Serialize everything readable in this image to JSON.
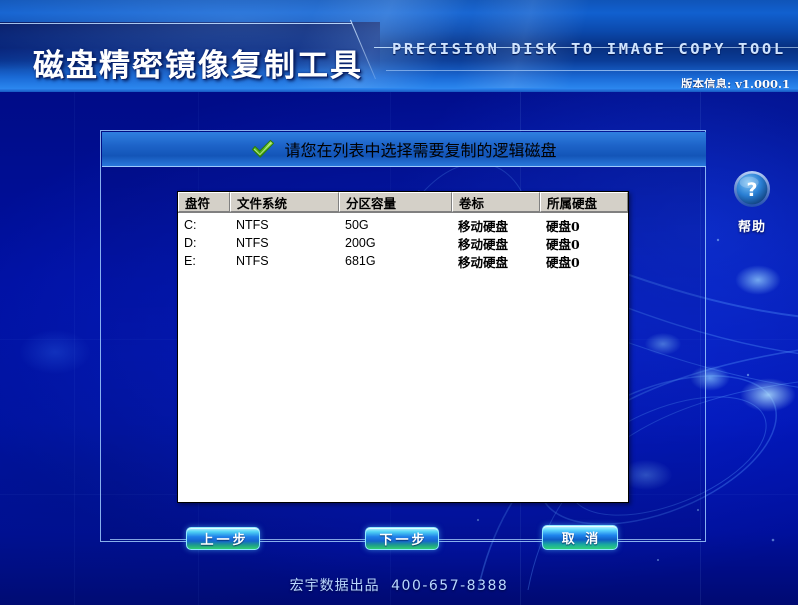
{
  "header": {
    "title_cn": "磁盘精密镜像复制工具",
    "title_en": "PRECISION DISK TO IMAGE COPY TOOL",
    "version": "版本信息: v1.000.1"
  },
  "dialog": {
    "title": "请您在列表中选择需要复制的逻辑磁盘",
    "check_icon": "check-icon",
    "table": {
      "columns": [
        "盘符",
        "文件系统",
        "分区容量",
        "卷标",
        "所属硬盘"
      ],
      "rows": [
        {
          "drive": "C:",
          "fs": "NTFS",
          "size": "50G",
          "label": "移动硬盘",
          "disk": "硬盘0"
        },
        {
          "drive": "D:",
          "fs": "NTFS",
          "size": "200G",
          "label": "移动硬盘",
          "disk": "硬盘0"
        },
        {
          "drive": "E:",
          "fs": "NTFS",
          "size": "681G",
          "label": "移动硬盘",
          "disk": "硬盘0"
        }
      ]
    }
  },
  "buttons": {
    "prev": "上一步",
    "next": "下一步",
    "cancel": "取 消"
  },
  "help": {
    "icon": "question-mark-icon",
    "label": "帮助"
  },
  "footer": {
    "company": "宏宇数据出品",
    "phone": "400-657-8388"
  },
  "colors": {
    "accent_blue": "#1d63c8",
    "header_blue": "#0f54b8",
    "background_navy": "#000d8c",
    "button_cyan": "#4fd2f5",
    "button_green": "#2fcf72",
    "check_green": "#4caf21",
    "listbox_white": "#ffffff",
    "header_cell_gray": "#d4d0c8"
  }
}
